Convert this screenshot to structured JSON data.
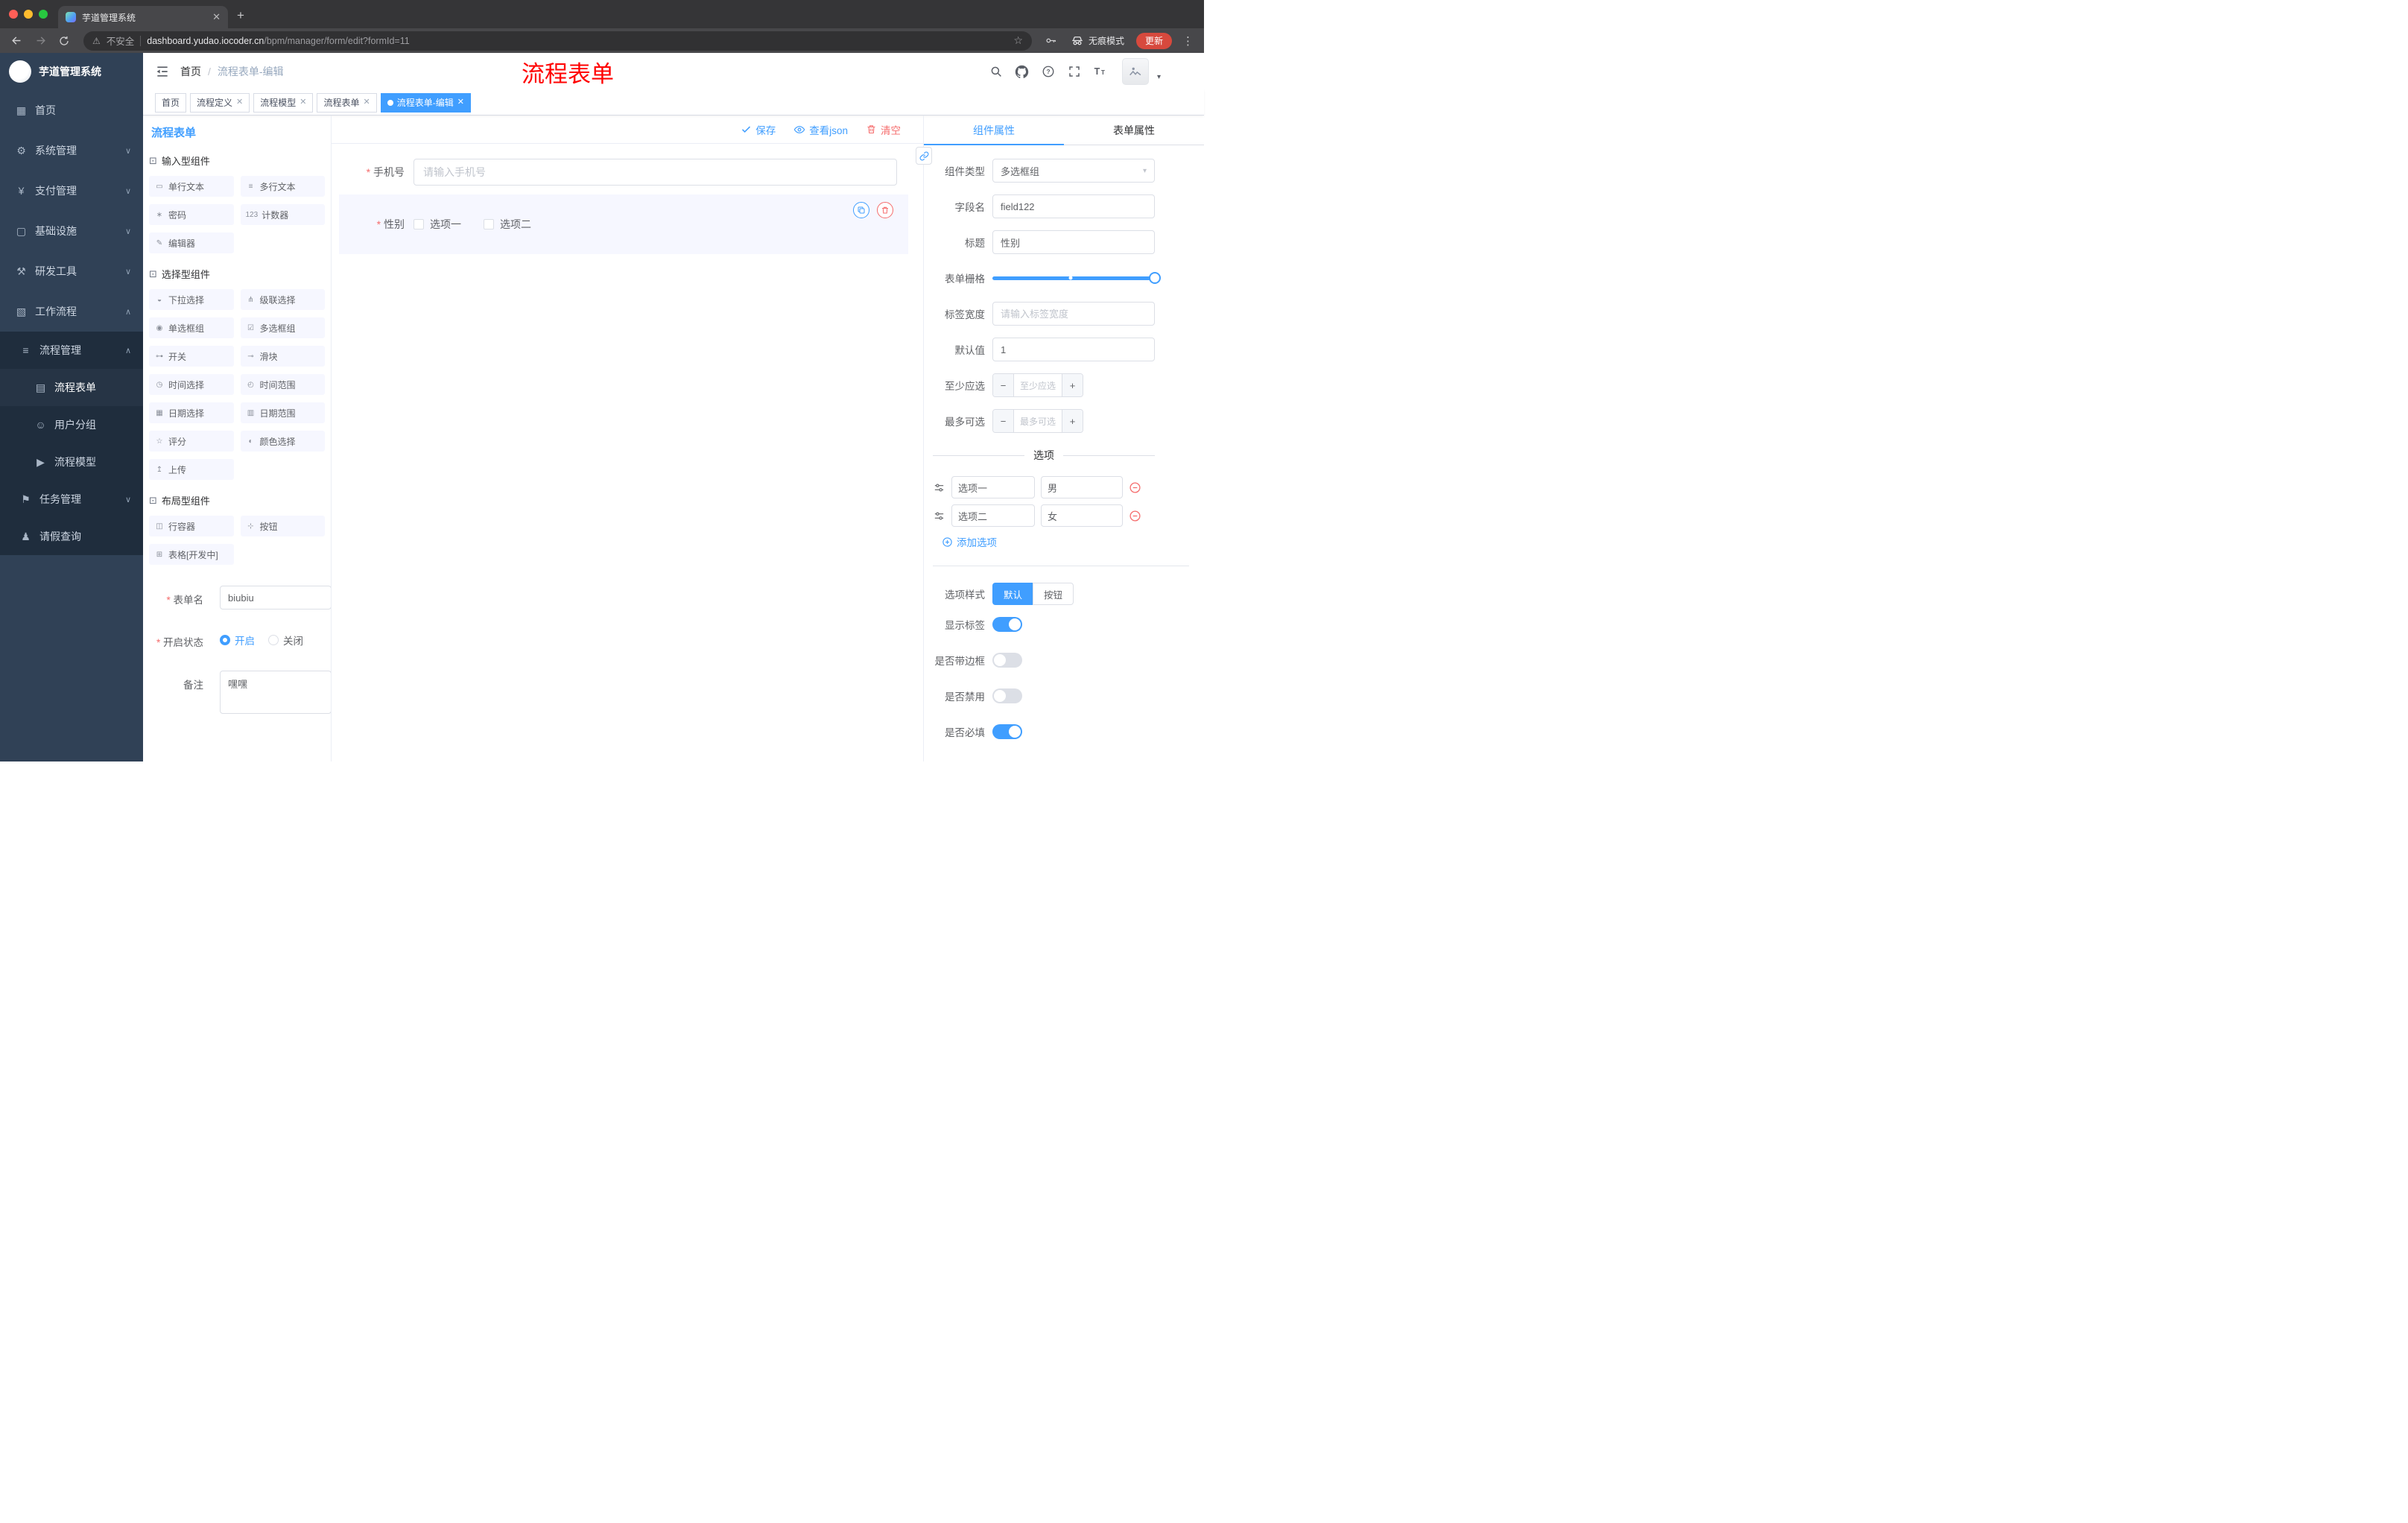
{
  "browser": {
    "tab_title": "芋道管理系统",
    "security_label": "不安全",
    "url_domain": "dashboard.yudao.iocoder.cn",
    "url_path": "/bpm/manager/form/edit?formId=11",
    "incognito_label": "无痕模式",
    "update_label": "更新"
  },
  "sidebar": {
    "logo_title": "芋道管理系统",
    "items": [
      {
        "icon": "dashboard-icon",
        "glyph": "▦",
        "label": "首页",
        "level": 1
      },
      {
        "icon": "gear-icon",
        "glyph": "⚙",
        "label": "系统管理",
        "level": 1,
        "chevron": "∨"
      },
      {
        "icon": "payment-icon",
        "glyph": "¥",
        "label": "支付管理",
        "level": 1,
        "chevron": "∨"
      },
      {
        "icon": "infrastructure-icon",
        "glyph": "▢",
        "label": "基础设施",
        "level": 1,
        "chevron": "∨"
      },
      {
        "icon": "devtools-icon",
        "glyph": "⚒",
        "label": "研发工具",
        "level": 1,
        "chevron": "∨"
      },
      {
        "icon": "workflow-icon",
        "glyph": "▧",
        "label": "工作流程",
        "level": 1,
        "chevron": "∧"
      },
      {
        "icon": "process-manage-icon",
        "glyph": "≡",
        "label": "流程管理",
        "level": 2,
        "chevron": "∧"
      },
      {
        "icon": "process-form-icon",
        "glyph": "▤",
        "label": "流程表单",
        "level": 3,
        "active": true
      },
      {
        "icon": "user-group-icon",
        "glyph": "☺",
        "label": "用户分组",
        "level": 3
      },
      {
        "icon": "process-model-icon",
        "glyph": "▶",
        "label": "流程模型",
        "level": 3
      },
      {
        "icon": "task-manage-icon",
        "glyph": "⚑",
        "label": "任务管理",
        "level": 2,
        "chevron": "∨"
      },
      {
        "icon": "leave-query-icon",
        "glyph": "♟",
        "label": "请假查询",
        "level": 2
      }
    ]
  },
  "navbar": {
    "breadcrumb": {
      "home": "首页",
      "separator": "/",
      "current": "流程表单-编辑"
    },
    "annotation": "流程表单"
  },
  "tags": [
    {
      "label": "首页",
      "closable": false,
      "active": false
    },
    {
      "label": "流程定义",
      "closable": true,
      "active": false
    },
    {
      "label": "流程模型",
      "closable": true,
      "active": false
    },
    {
      "label": "流程表单",
      "closable": true,
      "active": false
    },
    {
      "label": "流程表单-编辑",
      "closable": true,
      "active": true
    }
  ],
  "palette": {
    "title": "流程表单",
    "sections": [
      {
        "title": "输入型组件",
        "items": [
          {
            "icon": "single-line-text-icon",
            "glyph": "▭",
            "label": "单行文本"
          },
          {
            "icon": "multi-line-text-icon",
            "glyph": "≡",
            "label": "多行文本"
          },
          {
            "icon": "password-icon",
            "glyph": "∗",
            "label": "密码"
          },
          {
            "icon": "counter-icon",
            "glyph": "123",
            "label": "计数器"
          },
          {
            "icon": "editor-icon",
            "glyph": "✎",
            "label": "编辑器"
          }
        ]
      },
      {
        "title": "选择型组件",
        "items": [
          {
            "icon": "select-icon",
            "glyph": "◒",
            "label": "下拉选择"
          },
          {
            "icon": "cascader-icon",
            "glyph": "⋔",
            "label": "级联选择"
          },
          {
            "icon": "radio-group-icon",
            "glyph": "◉",
            "label": "单选框组"
          },
          {
            "icon": "checkbox-group-icon",
            "glyph": "☑",
            "label": "多选框组"
          },
          {
            "icon": "switch-icon",
            "glyph": "⊶",
            "label": "开关"
          },
          {
            "icon": "slider-icon",
            "glyph": "⊸",
            "label": "滑块"
          },
          {
            "icon": "time-picker-icon",
            "glyph": "◷",
            "label": "时间选择"
          },
          {
            "icon": "time-range-icon",
            "glyph": "◴",
            "label": "时间范围"
          },
          {
            "icon": "date-picker-icon",
            "glyph": "▦",
            "label": "日期选择"
          },
          {
            "icon": "date-range-icon",
            "glyph": "▥",
            "label": "日期范围"
          },
          {
            "icon": "rate-icon",
            "glyph": "☆",
            "label": "评分"
          },
          {
            "icon": "color-picker-icon",
            "glyph": "◐",
            "label": "颜色选择"
          },
          {
            "icon": "upload-icon",
            "glyph": "↥",
            "label": "上传"
          }
        ]
      },
      {
        "title": "布局型组件",
        "items": [
          {
            "icon": "row-container-icon",
            "glyph": "◫",
            "label": "行容器"
          },
          {
            "icon": "button-icon",
            "glyph": "⊹",
            "label": "按钮"
          },
          {
            "icon": "table-icon",
            "glyph": "⊞",
            "label": "表格[开发中]"
          }
        ]
      }
    ],
    "form": {
      "name_label": "表单名",
      "name_value": "biubiu",
      "status_label": "开启状态",
      "status_on": "开启",
      "status_off": "关闭",
      "status_selected": "开启",
      "remark_label": "备注",
      "remark_value": "嘿嘿"
    }
  },
  "canvas": {
    "toolbar": {
      "save": "保存",
      "view_json": "查看json",
      "clear": "清空"
    },
    "phone_field": {
      "label": "手机号",
      "required": true,
      "placeholder": "请输入手机号"
    },
    "gender_field": {
      "label": "性别",
      "required": true,
      "selected": true,
      "options": [
        "选项一",
        "选项二"
      ]
    }
  },
  "props": {
    "tab_component": "组件属性",
    "tab_form": "表单属性",
    "active_tab": "组件属性",
    "component_type_label": "组件类型",
    "component_type_value": "多选框组",
    "field_name_label": "字段名",
    "field_name_value": "field122",
    "title_label": "标题",
    "title_value": "性别",
    "grid_label": "表单栅格",
    "label_width_label": "标签宽度",
    "label_width_placeholder": "请输入标签宽度",
    "default_label": "默认值",
    "default_value": "1",
    "min_label": "至少应选",
    "min_placeholder": "至少应选",
    "max_label": "最多可选",
    "max_placeholder": "最多可选",
    "options_title": "选项",
    "options": [
      {
        "label": "选项一",
        "value": "男"
      },
      {
        "label": "选项二",
        "value": "女"
      }
    ],
    "add_option": "添加选项",
    "style_label": "选项样式",
    "style_default": "默认",
    "style_button": "按钮",
    "style_selected": "默认",
    "switch_show_label": "显示标签",
    "switch_border": "是否带边框",
    "switch_disabled": "是否禁用",
    "switch_required": "是否必填",
    "switch_states": {
      "show_label": true,
      "border": false,
      "disabled": false,
      "required": true
    }
  },
  "colors": {
    "accent": "#409eff",
    "danger": "#f56c6c",
    "annotation_red": "#ff0000",
    "sidebar_bg": "#304156",
    "submenu_bg": "#1f2d3d",
    "selected_row_bg": "#f6f7ff"
  }
}
